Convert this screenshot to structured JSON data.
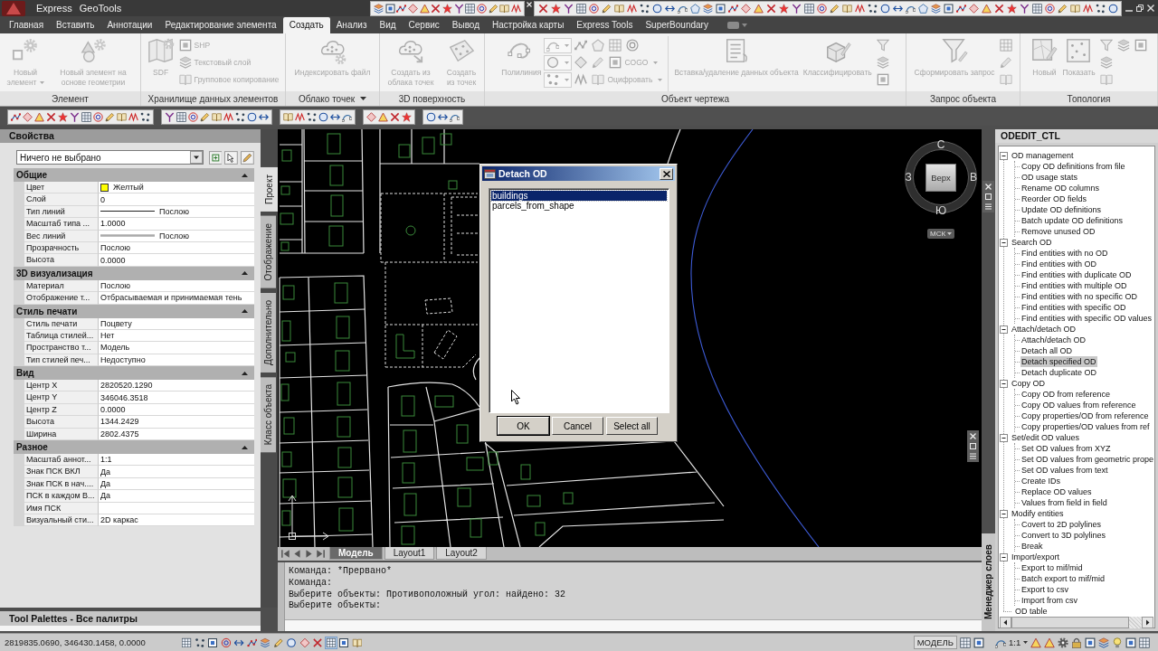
{
  "app_bar": {
    "menus": [
      "Express",
      "GeoTools"
    ]
  },
  "ribbon": {
    "tabs": [
      {
        "label": "Главная",
        "selected": false
      },
      {
        "label": "Вставить",
        "selected": false
      },
      {
        "label": "Аннотации",
        "selected": false
      },
      {
        "label": "Редактирование элемента",
        "selected": false
      },
      {
        "label": "Создать",
        "selected": true
      },
      {
        "label": "Анализ",
        "selected": false
      },
      {
        "label": "Вид",
        "selected": false
      },
      {
        "label": "Сервис",
        "selected": false
      },
      {
        "label": "Вывод",
        "selected": false
      },
      {
        "label": "Настройка карты",
        "selected": false
      },
      {
        "label": "Express Tools",
        "selected": false
      },
      {
        "label": "SuperBoundary",
        "selected": false
      }
    ],
    "panels": [
      {
        "title": "Элемент",
        "items": [
          {
            "kind": "large",
            "label": "Новый элемент",
            "dropdown": true,
            "disabled": true
          },
          {
            "kind": "large",
            "label": "Новый элемент на основе геометрии",
            "disabled": true
          }
        ]
      },
      {
        "title": "Хранилище данных элементов",
        "items": [
          {
            "kind": "large",
            "label": "SDF",
            "disabled": true
          },
          {
            "kind": "stack",
            "rows": [
              [
                {
                  "label": "SHP",
                  "disabled": true
                }
              ],
              [
                {
                  "label": "Текстовый слой",
                  "disabled": true
                }
              ],
              [
                {
                  "label": "Групповое копирование",
                  "disabled": true
                }
              ]
            ]
          }
        ]
      },
      {
        "title": "Облако точек",
        "title_dropdown": true,
        "items": [
          {
            "kind": "large",
            "label": "Индексировать файл",
            "disabled": true
          }
        ]
      },
      {
        "title": "3D поверхность",
        "items": [
          {
            "kind": "large",
            "label": "Создать из облака точек",
            "disabled": true
          },
          {
            "kind": "large",
            "label": "Создать из точек",
            "disabled": true
          }
        ]
      },
      {
        "title": "Объект чертежа",
        "items": [
          {
            "kind": "large",
            "label": "Полилиния",
            "disabled": true
          },
          {
            "kind": "stack",
            "rows": [
              [
                {
                  "dropdown": true,
                  "disabled": true
                },
                {
                  "disabled": true
                }
              ],
              [
                {
                  "dropdown": true,
                  "disabled": true
                },
                {
                  "disabled": true
                }
              ],
              [
                {
                  "dropdown": true,
                  "disabled": true
                },
                {
                  "disabled": true
                }
              ]
            ]
          },
          {
            "kind": "stack",
            "rows": [
              [
                {
                  "disabled": true
                },
                {
                  "disabled": true
                },
                {
                  "disabled": true
                }
              ],
              [
                {
                  "disabled": true
                },
                {
                  "label": "COGO",
                  "dropdown": true,
                  "disabled": true
                }
              ],
              [
                {
                  "label": "Оцифровать",
                  "dropdown": true,
                  "disabled": true
                }
              ]
            ]
          },
          {
            "kind": "separator"
          },
          {
            "kind": "large",
            "label": "Вставка/удаление данных объекта",
            "disabled": true
          },
          {
            "kind": "large",
            "label": "Классифицировать",
            "disabled": true
          },
          {
            "kind": "stack",
            "rows": [
              [
                {
                  "disabled": true
                }
              ],
              [
                {
                  "disabled": true
                }
              ],
              [
                {
                  "disabled": true
                }
              ]
            ]
          }
        ]
      },
      {
        "title": "Запрос объекта",
        "items": [
          {
            "kind": "large",
            "label": "Сформировать запрос",
            "disabled": true
          },
          {
            "kind": "stack",
            "rows": [
              [
                {
                  "disabled": true
                }
              ],
              [
                {
                  "disabled": true
                }
              ],
              [
                {
                  "disabled": true
                }
              ]
            ]
          }
        ]
      },
      {
        "title": "Топология",
        "items": [
          {
            "kind": "large",
            "label": "Новый",
            "disabled": true
          },
          {
            "kind": "large",
            "label": "Показать",
            "disabled": true
          },
          {
            "kind": "stack",
            "rows": [
              [
                {
                  "disabled": true
                },
                {
                  "disabled": true
                },
                {
                  "disabled": true
                }
              ],
              [
                {
                  "disabled": true
                }
              ],
              [
                {
                  "disabled": true
                }
              ]
            ]
          }
        ]
      }
    ]
  },
  "properties": {
    "title": "Свойства",
    "selection": "Ничего не выбрано",
    "sections": [
      {
        "title": "Общие",
        "expanded": true,
        "rows": [
          {
            "kind": "color",
            "label": "Цвет",
            "value": "Желтый",
            "color": "#ffff00"
          },
          {
            "kind": "text",
            "label": "Слой",
            "value": "0"
          },
          {
            "kind": "linetype",
            "label": "Тип линий",
            "value": "Послою"
          },
          {
            "kind": "text",
            "label": "Масштаб типа ...",
            "value": "1.0000"
          },
          {
            "kind": "lineweight",
            "label": "Вес линий",
            "value": "Послою"
          },
          {
            "kind": "text",
            "label": "Прозрачность",
            "value": "Послою"
          },
          {
            "kind": "text",
            "label": "Высота",
            "value": "0.0000"
          }
        ]
      },
      {
        "title": "3D визуализация",
        "expanded": true,
        "rows": [
          {
            "kind": "text",
            "label": "Материал",
            "value": "Послою"
          },
          {
            "kind": "text",
            "label": "Отображение т...",
            "value": "Отбрасываемая и принимаемая тень"
          }
        ]
      },
      {
        "title": "Стиль печати",
        "expanded": true,
        "rows": [
          {
            "kind": "text",
            "label": "Стиль печати",
            "value": "Поцвету"
          },
          {
            "kind": "text",
            "label": "Таблица стилей...",
            "value": "Нет"
          },
          {
            "kind": "text",
            "label": "Пространство т...",
            "value": "Модель"
          },
          {
            "kind": "text",
            "label": "Тип стилей печ...",
            "value": "Недоступно"
          }
        ]
      },
      {
        "title": "Вид",
        "expanded": true,
        "rows": [
          {
            "kind": "text",
            "label": "Центр X",
            "value": "2820520.1290"
          },
          {
            "kind": "text",
            "label": "Центр Y",
            "value": "346046.3518"
          },
          {
            "kind": "text",
            "label": "Центр Z",
            "value": "0.0000"
          },
          {
            "kind": "text",
            "label": "Высота",
            "value": "1344.2429"
          },
          {
            "kind": "text",
            "label": "Ширина",
            "value": "2802.4375"
          }
        ]
      },
      {
        "title": "Разное",
        "expanded": true,
        "rows": [
          {
            "kind": "text",
            "label": "Масштаб аннот...",
            "value": "1:1"
          },
          {
            "kind": "text",
            "label": "Знак ПСК ВКЛ",
            "value": "Да"
          },
          {
            "kind": "text",
            "label": "Знак ПСК в нач....",
            "value": "Да"
          },
          {
            "kind": "text",
            "label": "ПСК в каждом В...",
            "value": "Да"
          },
          {
            "kind": "text",
            "label": "Имя ПСК"
          },
          {
            "kind": "text",
            "label": "Визуальный сти...",
            "value": "2D каркас"
          }
        ]
      }
    ],
    "tabs": [
      {
        "label": "Проект",
        "selected": true
      },
      {
        "label": "Отображение",
        "selected": false
      },
      {
        "label": "Дополнительно",
        "selected": false
      },
      {
        "label": "Класс объекта",
        "selected": false
      }
    ]
  },
  "tool_palettes": {
    "title": "Tool Palettes - Все палитры"
  },
  "viewport": {
    "viewcube": {
      "north": "С",
      "east": "В",
      "south": "Ю",
      "west": "З",
      "top": "Верх",
      "coordinate_system": "МСК"
    },
    "layout_tabs": [
      {
        "label": "Модель",
        "selected": true
      },
      {
        "label": "Layout1",
        "selected": false
      },
      {
        "label": "Layout2",
        "selected": false
      }
    ]
  },
  "dialog": {
    "title": "Detach OD",
    "items": [
      {
        "label": "buildings",
        "selected": true
      },
      {
        "label": "parcels_from_shape",
        "selected": false
      }
    ],
    "buttons": [
      {
        "label": "OK",
        "default": true
      },
      {
        "label": "Cancel",
        "default": false
      },
      {
        "label": "Select all",
        "default": false
      }
    ]
  },
  "command_line": {
    "history": [
      "Команда: *Прервано*",
      "Команда:",
      "Выберите объекты: Противоположный угол: найдено: 32",
      "Выберите объекты:"
    ]
  },
  "layer_manager_tab": "Менеджер слоев",
  "odedit": {
    "title": "ODEDIT_CTL",
    "tree": [
      {
        "label": "OD management",
        "expanded": true,
        "selected": false,
        "children": [
          {
            "label": "Copy OD definitions from file",
            "selected": false
          },
          {
            "label": "OD usage stats",
            "selected": false
          },
          {
            "label": "Rename OD columns",
            "selected": false
          },
          {
            "label": "Reorder OD fields",
            "selected": false
          },
          {
            "label": "Update OD definitions",
            "selected": false
          },
          {
            "label": "Batch update OD definitions",
            "selected": false
          },
          {
            "label": "Remove unused OD",
            "selected": false
          }
        ]
      },
      {
        "label": "Search OD",
        "expanded": true,
        "selected": false,
        "children": [
          {
            "label": "Find entities with no OD",
            "selected": false
          },
          {
            "label": "Find entities with OD",
            "selected": false
          },
          {
            "label": "Find entities with duplicate OD",
            "selected": false
          },
          {
            "label": "Find entities with multiple OD",
            "selected": false
          },
          {
            "label": "Find entities with no specific OD",
            "selected": false
          },
          {
            "label": "Find entities with specific OD",
            "selected": false
          },
          {
            "label": "Find entities with specific OD values",
            "selected": false
          }
        ]
      },
      {
        "label": "Attach/detach OD",
        "expanded": true,
        "selected": false,
        "children": [
          {
            "label": "Attach/detach OD",
            "selected": false
          },
          {
            "label": "Detach all OD",
            "selected": false
          },
          {
            "label": "Detach specified OD",
            "selected": true
          },
          {
            "label": "Detach duplicate OD",
            "selected": false
          }
        ]
      },
      {
        "label": "Copy OD",
        "expanded": true,
        "selected": false,
        "children": [
          {
            "label": "Copy OD from reference",
            "selected": false
          },
          {
            "label": "Copy OD values from reference",
            "selected": false
          },
          {
            "label": "Copy properties/OD from reference",
            "selected": false
          },
          {
            "label": "Copy properties/OD values from ref",
            "selected": false
          }
        ]
      },
      {
        "label": "Set/edit OD values",
        "expanded": true,
        "selected": false,
        "children": [
          {
            "label": "Set OD values from XYZ",
            "selected": false
          },
          {
            "label": "Set OD values from geometric prope",
            "selected": false
          },
          {
            "label": "Set OD values from text",
            "selected": false
          },
          {
            "label": "Create IDs",
            "selected": false
          },
          {
            "label": "Replace OD values",
            "selected": false
          },
          {
            "label": "Values from field in field",
            "selected": false
          }
        ]
      },
      {
        "label": "Modify entities",
        "expanded": true,
        "selected": false,
        "children": [
          {
            "label": "Covert to 2D polylines",
            "selected": false
          },
          {
            "label": "Convert to 3D polylines",
            "selected": false
          },
          {
            "label": "Break",
            "selected": false
          }
        ]
      },
      {
        "label": "Import/export",
        "expanded": true,
        "selected": false,
        "children": [
          {
            "label": "Export to mif/mid",
            "selected": false
          },
          {
            "label": "Batch export to mif/mid",
            "selected": false
          },
          {
            "label": "Export to csv",
            "selected": false
          },
          {
            "label": "Import from csv",
            "selected": false
          }
        ]
      },
      {
        "label": "OD table",
        "selected": false
      }
    ]
  },
  "status_bar": {
    "coordinates": "2819835.0690, 346430.1458, 0.0000",
    "toggles": [
      {
        "on": false
      },
      {
        "on": false
      },
      {
        "on": false
      },
      {
        "on": false
      },
      {
        "on": false
      },
      {
        "on": false
      },
      {
        "on": false
      },
      {
        "on": false
      },
      {
        "on": false
      },
      {
        "on": false
      },
      {
        "on": false
      },
      {
        "on": true
      },
      {
        "on": false
      },
      {
        "on": false
      }
    ],
    "space": "МОДЕЛЬ",
    "annotation_scale": "1:1"
  }
}
